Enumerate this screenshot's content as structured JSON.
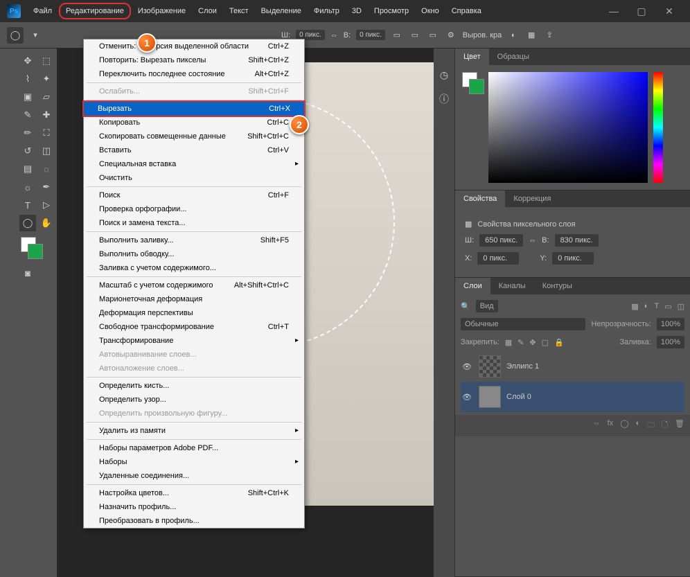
{
  "menubar": {
    "items": [
      "Файл",
      "Редактирование",
      "Изображение",
      "Слои",
      "Текст",
      "Выделение",
      "Фильтр",
      "3D",
      "Просмотр",
      "Окно",
      "Справка"
    ],
    "highlighted_index": 1
  },
  "optbar": {
    "w_label": "Ш:",
    "w_val": "0 пикс.",
    "h_label": "В:",
    "h_val": "0 пикс.",
    "align": "Выров. кра"
  },
  "marker1": "1",
  "marker2": "2",
  "edit_menu": {
    "items": [
      {
        "t": "item",
        "label": "Отменить: Инверсия выделенной области",
        "sc": "Ctrl+Z"
      },
      {
        "t": "item",
        "label": "Повторить: Вырезать пикселы",
        "sc": "Shift+Ctrl+Z"
      },
      {
        "t": "item",
        "label": "Переключить последнее состояние",
        "sc": "Alt+Ctrl+Z"
      },
      {
        "t": "sep"
      },
      {
        "t": "item",
        "label": "Ослабить...",
        "sc": "Shift+Ctrl+F",
        "dis": true
      },
      {
        "t": "sep"
      },
      {
        "t": "item",
        "label": "Вырезать",
        "sc": "Ctrl+X",
        "hl": true
      },
      {
        "t": "item",
        "label": "Копировать",
        "sc": "Ctrl+C"
      },
      {
        "t": "item",
        "label": "Скопировать совмещенные данные",
        "sc": "Shift+Ctrl+C"
      },
      {
        "t": "item",
        "label": "Вставить",
        "sc": "Ctrl+V"
      },
      {
        "t": "sub",
        "label": "Специальная вставка"
      },
      {
        "t": "item",
        "label": "Очистить"
      },
      {
        "t": "sep"
      },
      {
        "t": "item",
        "label": "Поиск",
        "sc": "Ctrl+F"
      },
      {
        "t": "item",
        "label": "Проверка орфографии..."
      },
      {
        "t": "item",
        "label": "Поиск и замена текста..."
      },
      {
        "t": "sep"
      },
      {
        "t": "item",
        "label": "Выполнить заливку...",
        "sc": "Shift+F5"
      },
      {
        "t": "item",
        "label": "Выполнить обводку..."
      },
      {
        "t": "item",
        "label": "Заливка с учетом содержимого..."
      },
      {
        "t": "sep"
      },
      {
        "t": "item",
        "label": "Масштаб с учетом содержимого",
        "sc": "Alt+Shift+Ctrl+C"
      },
      {
        "t": "item",
        "label": "Марионеточная деформация"
      },
      {
        "t": "item",
        "label": "Деформация перспективы"
      },
      {
        "t": "item",
        "label": "Свободное трансформирование",
        "sc": "Ctrl+T"
      },
      {
        "t": "sub",
        "label": "Трансформирование"
      },
      {
        "t": "item",
        "label": "Автовыравнивание слоев...",
        "dis": true
      },
      {
        "t": "item",
        "label": "Автоналожение слоев...",
        "dis": true
      },
      {
        "t": "sep"
      },
      {
        "t": "item",
        "label": "Определить кисть..."
      },
      {
        "t": "item",
        "label": "Определить узор..."
      },
      {
        "t": "item",
        "label": "Определить произвольную фигуру...",
        "dis": true
      },
      {
        "t": "sep"
      },
      {
        "t": "sub",
        "label": "Удалить из памяти"
      },
      {
        "t": "sep"
      },
      {
        "t": "item",
        "label": "Наборы параметров Adobe PDF..."
      },
      {
        "t": "sub",
        "label": "Наборы"
      },
      {
        "t": "item",
        "label": "Удаленные соединения..."
      },
      {
        "t": "sep"
      },
      {
        "t": "item",
        "label": "Настройка цветов...",
        "sc": "Shift+Ctrl+K"
      },
      {
        "t": "item",
        "label": "Назначить профиль..."
      },
      {
        "t": "item",
        "label": "Преобразовать в профиль..."
      }
    ]
  },
  "panels": {
    "color_tab": "Цвет",
    "swatch_tab": "Образцы",
    "props_tab": "Свойства",
    "adjust_tab": "Коррекция",
    "props_title": "Свойства пиксельного слоя",
    "w_lab": "Ш:",
    "w_val": "650 пикс.",
    "h_lab": "В:",
    "h_val": "830 пикс.",
    "x_lab": "X:",
    "x_val": "0 пикс.",
    "y_lab": "Y:",
    "y_val": "0 пикс.",
    "layers_tab": "Слои",
    "channels_tab": "Каналы",
    "paths_tab": "Контуры",
    "search": "Вид",
    "blend": "Обычные",
    "opacity_lab": "Непрозрачность:",
    "opacity_val": "100%",
    "lock_lab": "Закрепить:",
    "fill_lab": "Заливка:",
    "fill_val": "100%",
    "layer1": "Эллипс 1",
    "layer2": "Слой 0"
  }
}
